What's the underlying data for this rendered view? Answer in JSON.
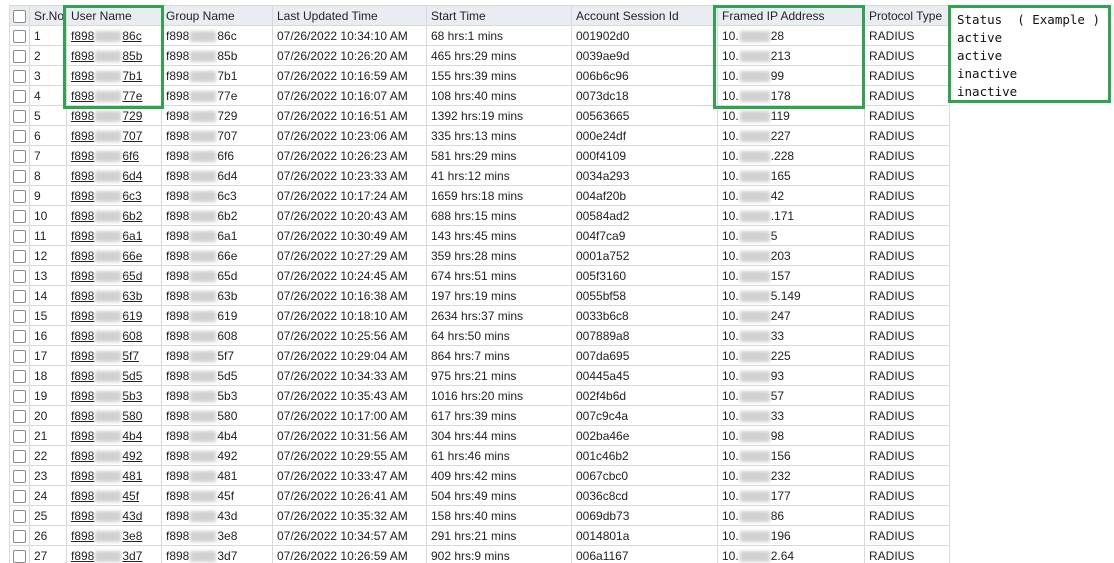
{
  "columns": [
    "Sr.No",
    "User Name",
    "Group Name",
    "Last Updated Time",
    "Start Time",
    "Account Session Id",
    "Framed IP Address",
    "Protocol Type"
  ],
  "rows": [
    {
      "sr": "1",
      "user_pre": "f898",
      "user_suf": "86c",
      "group_pre": "f898",
      "group_suf": "86c",
      "updated": "07/26/2022 10:34:10 AM",
      "start": "68 hrs:1 mins",
      "session": "001902d0",
      "ip_pre": "10.",
      "ip_suf": "28",
      "protocol": "RADIUS"
    },
    {
      "sr": "2",
      "user_pre": "f898",
      "user_suf": "85b",
      "group_pre": "f898",
      "group_suf": "85b",
      "updated": "07/26/2022 10:26:20 AM",
      "start": "465 hrs:29 mins",
      "session": "0039ae9d",
      "ip_pre": "10.",
      "ip_suf": "213",
      "protocol": "RADIUS"
    },
    {
      "sr": "3",
      "user_pre": "f898",
      "user_suf": "7b1",
      "group_pre": "f898",
      "group_suf": "7b1",
      "updated": "07/26/2022 10:16:59 AM",
      "start": "155 hrs:39 mins",
      "session": "006b6c96",
      "ip_pre": "10.",
      "ip_suf": "99",
      "protocol": "RADIUS"
    },
    {
      "sr": "4",
      "user_pre": "f898",
      "user_suf": "77e",
      "group_pre": "f898",
      "group_suf": "77e",
      "updated": "07/26/2022 10:16:07 AM",
      "start": "108 hrs:40 mins",
      "session": "0073dc18",
      "ip_pre": "10.",
      "ip_suf": "178",
      "protocol": "RADIUS"
    },
    {
      "sr": "5",
      "user_pre": "f898",
      "user_suf": "729",
      "group_pre": "f898",
      "group_suf": "729",
      "updated": "07/26/2022 10:16:51 AM",
      "start": "1392 hrs:19 mins",
      "session": "00563665",
      "ip_pre": "10.",
      "ip_suf": "119",
      "protocol": "RADIUS"
    },
    {
      "sr": "6",
      "user_pre": "f898",
      "user_suf": "707",
      "group_pre": "f898",
      "group_suf": "707",
      "updated": "07/26/2022 10:23:06 AM",
      "start": "335 hrs:13 mins",
      "session": "000e24df",
      "ip_pre": "10.",
      "ip_suf": "227",
      "protocol": "RADIUS"
    },
    {
      "sr": "7",
      "user_pre": "f898",
      "user_suf": "6f6",
      "group_pre": "f898",
      "group_suf": "6f6",
      "updated": "07/26/2022 10:26:23 AM",
      "start": "581 hrs:29 mins",
      "session": "000f4109",
      "ip_pre": "10.",
      "ip_suf": ".228",
      "protocol": "RADIUS"
    },
    {
      "sr": "8",
      "user_pre": "f898",
      "user_suf": "6d4",
      "group_pre": "f898",
      "group_suf": "6d4",
      "updated": "07/26/2022 10:23:33 AM",
      "start": "41 hrs:12 mins",
      "session": "0034a293",
      "ip_pre": "10.",
      "ip_suf": "165",
      "protocol": "RADIUS"
    },
    {
      "sr": "9",
      "user_pre": "f898",
      "user_suf": "6c3",
      "group_pre": "f898",
      "group_suf": "6c3",
      "updated": "07/26/2022 10:17:24 AM",
      "start": "1659 hrs:18 mins",
      "session": "004af20b",
      "ip_pre": "10.",
      "ip_suf": "42",
      "protocol": "RADIUS"
    },
    {
      "sr": "10",
      "user_pre": "f898",
      "user_suf": "6b2",
      "group_pre": "f898",
      "group_suf": "6b2",
      "updated": "07/26/2022 10:20:43 AM",
      "start": "688 hrs:15 mins",
      "session": "00584ad2",
      "ip_pre": "10.",
      "ip_suf": ".171",
      "protocol": "RADIUS"
    },
    {
      "sr": "11",
      "user_pre": "f898",
      "user_suf": "6a1",
      "group_pre": "f898",
      "group_suf": "6a1",
      "updated": "07/26/2022 10:30:49 AM",
      "start": "143 hrs:45 mins",
      "session": "004f7ca9",
      "ip_pre": "10.",
      "ip_suf": "5",
      "protocol": "RADIUS"
    },
    {
      "sr": "12",
      "user_pre": "f898",
      "user_suf": "66e",
      "group_pre": "f898",
      "group_suf": "66e",
      "updated": "07/26/2022 10:27:29 AM",
      "start": "359 hrs:28 mins",
      "session": "0001a752",
      "ip_pre": "10.",
      "ip_suf": "203",
      "protocol": "RADIUS"
    },
    {
      "sr": "13",
      "user_pre": "f898",
      "user_suf": "65d",
      "group_pre": "f898",
      "group_suf": "65d",
      "updated": "07/26/2022 10:24:45 AM",
      "start": "674 hrs:51 mins",
      "session": "005f3160",
      "ip_pre": "10.",
      "ip_suf": "157",
      "protocol": "RADIUS"
    },
    {
      "sr": "14",
      "user_pre": "f898",
      "user_suf": "63b",
      "group_pre": "f898",
      "group_suf": "63b",
      "updated": "07/26/2022 10:16:38 AM",
      "start": "197 hrs:19 mins",
      "session": "0055bf58",
      "ip_pre": "10.",
      "ip_suf": "5.149",
      "protocol": "RADIUS"
    },
    {
      "sr": "15",
      "user_pre": "f898",
      "user_suf": "619",
      "group_pre": "f898",
      "group_suf": "619",
      "updated": "07/26/2022 10:18:10 AM",
      "start": "2634 hrs:37 mins",
      "session": "0033b6c8",
      "ip_pre": "10.",
      "ip_suf": "247",
      "protocol": "RADIUS"
    },
    {
      "sr": "16",
      "user_pre": "f898",
      "user_suf": "608",
      "group_pre": "f898",
      "group_suf": "608",
      "updated": "07/26/2022 10:25:56 AM",
      "start": "64 hrs:50 mins",
      "session": "007889a8",
      "ip_pre": "10.",
      "ip_suf": "33",
      "protocol": "RADIUS"
    },
    {
      "sr": "17",
      "user_pre": "f898",
      "user_suf": "5f7",
      "group_pre": "f898",
      "group_suf": "5f7",
      "updated": "07/26/2022 10:29:04 AM",
      "start": "864 hrs:7 mins",
      "session": "007da695",
      "ip_pre": "10.",
      "ip_suf": "225",
      "protocol": "RADIUS"
    },
    {
      "sr": "18",
      "user_pre": "f898",
      "user_suf": "5d5",
      "group_pre": "f898",
      "group_suf": "5d5",
      "updated": "07/26/2022 10:34:33 AM",
      "start": "975 hrs:21 mins",
      "session": "00445a45",
      "ip_pre": "10.",
      "ip_suf": "93",
      "protocol": "RADIUS"
    },
    {
      "sr": "19",
      "user_pre": "f898",
      "user_suf": "5b3",
      "group_pre": "f898",
      "group_suf": "5b3",
      "updated": "07/26/2022 10:35:43 AM",
      "start": "1016 hrs:20 mins",
      "session": "002f4b6d",
      "ip_pre": "10.",
      "ip_suf": "57",
      "protocol": "RADIUS"
    },
    {
      "sr": "20",
      "user_pre": "f898",
      "user_suf": "580",
      "group_pre": "f898",
      "group_suf": "580",
      "updated": "07/26/2022 10:17:00 AM",
      "start": "617 hrs:39 mins",
      "session": "007c9c4a",
      "ip_pre": "10.",
      "ip_suf": "33",
      "protocol": "RADIUS"
    },
    {
      "sr": "21",
      "user_pre": "f898",
      "user_suf": "4b4",
      "group_pre": "f898",
      "group_suf": "4b4",
      "updated": "07/26/2022 10:31:56 AM",
      "start": "304 hrs:44 mins",
      "session": "002ba46e",
      "ip_pre": "10.",
      "ip_suf": "98",
      "protocol": "RADIUS"
    },
    {
      "sr": "22",
      "user_pre": "f898",
      "user_suf": "492",
      "group_pre": "f898",
      "group_suf": "492",
      "updated": "07/26/2022 10:29:55 AM",
      "start": "61 hrs:46 mins",
      "session": "001c46b2",
      "ip_pre": "10.",
      "ip_suf": "156",
      "protocol": "RADIUS"
    },
    {
      "sr": "23",
      "user_pre": "f898",
      "user_suf": "481",
      "group_pre": "f898",
      "group_suf": "481",
      "updated": "07/26/2022 10:33:47 AM",
      "start": "409 hrs:42 mins",
      "session": "0067cbc0",
      "ip_pre": "10.",
      "ip_suf": "232",
      "protocol": "RADIUS"
    },
    {
      "sr": "24",
      "user_pre": "f898",
      "user_suf": "45f",
      "group_pre": "f898",
      "group_suf": "45f",
      "updated": "07/26/2022 10:26:41 AM",
      "start": "504 hrs:49 mins",
      "session": "0036c8cd",
      "ip_pre": "10.",
      "ip_suf": "177",
      "protocol": "RADIUS"
    },
    {
      "sr": "25",
      "user_pre": "f898",
      "user_suf": "43d",
      "group_pre": "f898",
      "group_suf": "43d",
      "updated": "07/26/2022 10:35:32 AM",
      "start": "158 hrs:40 mins",
      "session": "0069db73",
      "ip_pre": "10.",
      "ip_suf": "86",
      "protocol": "RADIUS"
    },
    {
      "sr": "26",
      "user_pre": "f898",
      "user_suf": "3e8",
      "group_pre": "f898",
      "group_suf": "3e8",
      "updated": "07/26/2022 10:34:57 AM",
      "start": "291 hrs:21 mins",
      "session": "0014801a",
      "ip_pre": "10.",
      "ip_suf": "196",
      "protocol": "RADIUS"
    },
    {
      "sr": "27",
      "user_pre": "f898",
      "user_suf": "3d7",
      "group_pre": "f898",
      "group_suf": "3d7",
      "updated": "07/26/2022 10:26:59 AM",
      "start": "902 hrs:9 mins",
      "session": "006a1167",
      "ip_pre": "10.",
      "ip_suf": "2.64",
      "protocol": "RADIUS"
    }
  ],
  "status_note": {
    "header": "Status  ( Example )",
    "lines": [
      "active",
      "active",
      "inactive",
      "inactive"
    ]
  },
  "colors": {
    "highlight": "#2ea44f",
    "header_bg": "#e9edf2",
    "grid_line": "#d6d9dd"
  }
}
